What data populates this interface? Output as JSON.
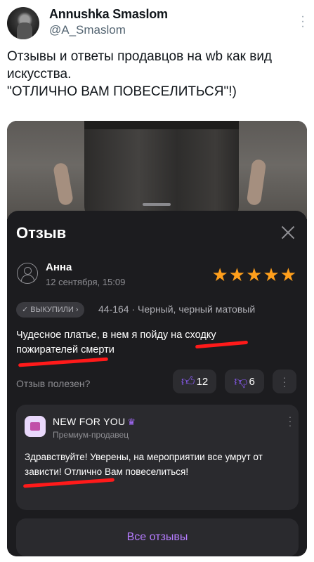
{
  "tweet": {
    "author_name": "Annushka Smaslom",
    "author_handle": "@A_Smaslom",
    "text_line1": "Отзывы и ответы продавцов на wb как вид искусства.",
    "text_line2": "\"ОТЛИЧНО ВАМ ПОВЕСЕЛИТЬСЯ\"!)"
  },
  "review_sheet": {
    "title": "Отзыв",
    "reviewer": "Анна",
    "date": "12 сентября, 15:09",
    "rating": 5,
    "stars": "★★★★★",
    "purchased_badge": "✓ ВЫКУПИЛИ ›",
    "variant": "44-164 · Черный, черный матовый",
    "text": "Чудесное платье, в нем я пойду на сходку пожирателей смерти",
    "helpful_label": "Отзыв полезен?",
    "likes": "12",
    "dislikes": "6"
  },
  "seller": {
    "name": "NEW FOR YOU",
    "type": "Премиум-продавец",
    "reply": "Здравствуйте! Уверены, на мероприятии все умрут от зависти! Отлично Вам повеселиться!"
  },
  "all_reviews_label": "Все отзывы",
  "colors": {
    "star": "#ff9f1c",
    "accent": "#b57cff",
    "underline": "#ff1a1a",
    "sheet_bg": "#1c1c1f"
  }
}
